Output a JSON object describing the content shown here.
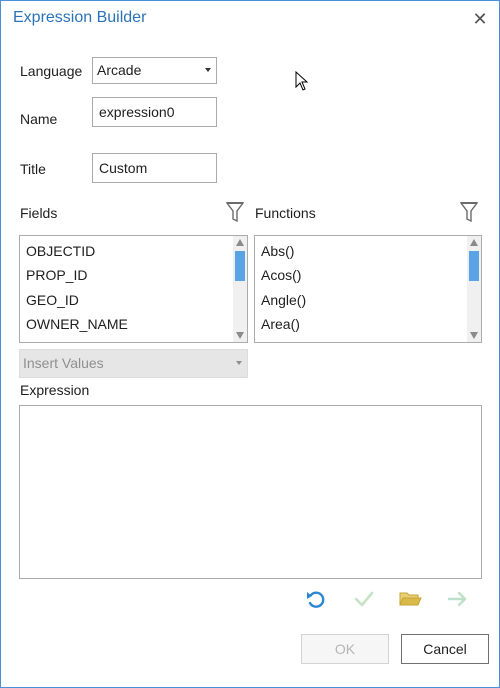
{
  "dialog": {
    "title": "Expression Builder"
  },
  "form": {
    "language_label": "Language",
    "language_value": "Arcade",
    "name_label": "Name",
    "name_value": "expression0",
    "title_label": "Title",
    "title_value": "Custom"
  },
  "fields": {
    "label": "Fields",
    "items": [
      "OBJECTID",
      "PROP_ID",
      "GEO_ID",
      "OWNER_NAME"
    ]
  },
  "functions": {
    "label": "Functions",
    "items": [
      "Abs()",
      "Acos()",
      "Angle()",
      "Area()"
    ]
  },
  "insert_values": {
    "label": "Insert Values"
  },
  "expression": {
    "label": "Expression",
    "value": ""
  },
  "toolbar_icons": [
    "undo-icon",
    "verify-check-icon",
    "open-folder-icon",
    "next-arrow-icon"
  ],
  "buttons": {
    "ok": "OK",
    "cancel": "Cancel"
  },
  "colors": {
    "title": "#2b73b8",
    "accent": "#4a90d9",
    "scroll_thumb": "#5aa4e6",
    "folder": "#d9b94a"
  }
}
